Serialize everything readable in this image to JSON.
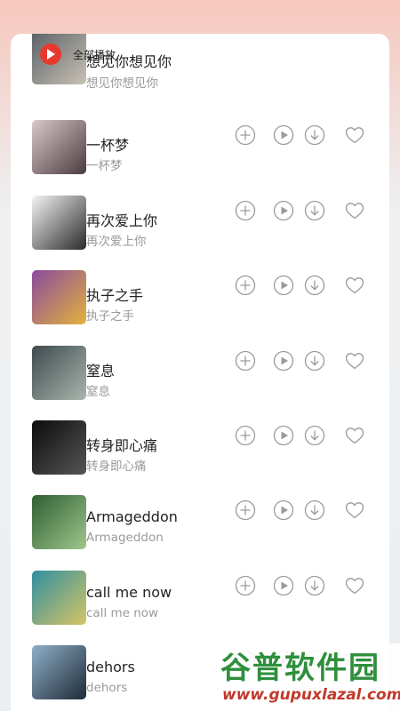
{
  "header": {
    "play_all_label": "全部播放"
  },
  "songs": [
    {
      "title": "想见你想见你",
      "artist": "想见你想见你",
      "cover_colors": [
        "#5a5f68",
        "#c9c2b4"
      ]
    },
    {
      "title": "一杯梦",
      "artist": "一杯梦",
      "cover_colors": [
        "#d9c8cc",
        "#4a3b3e"
      ]
    },
    {
      "title": "再次爱上你",
      "artist": "再次爱上你",
      "cover_colors": [
        "#f4f4f4",
        "#2a2a2a"
      ]
    },
    {
      "title": "执子之手",
      "artist": "执子之手",
      "cover_colors": [
        "#8a4a9e",
        "#e3b23c"
      ]
    },
    {
      "title": "窒息",
      "artist": "窒息",
      "cover_colors": [
        "#3e4a4e",
        "#a9b6ad"
      ]
    },
    {
      "title": "转身即心痛",
      "artist": "转身即心痛",
      "cover_colors": [
        "#0c0c0c",
        "#555555"
      ]
    },
    {
      "title": "Armageddon",
      "artist": "Armageddon",
      "cover_colors": [
        "#2f5e33",
        "#9fc78c"
      ]
    },
    {
      "title": "call me now",
      "artist": "call me now",
      "cover_colors": [
        "#2f8fa0",
        "#d7c466"
      ]
    },
    {
      "title": "dehors",
      "artist": "dehors",
      "cover_colors": [
        "#8fb0c8",
        "#1e2a38"
      ]
    }
  ],
  "watermark": {
    "top": "谷普软件园",
    "bottom": "www.gupuxlazal.com"
  },
  "colors": {
    "accent": "#e8392e",
    "icon_gray": "#9a9a9a"
  }
}
